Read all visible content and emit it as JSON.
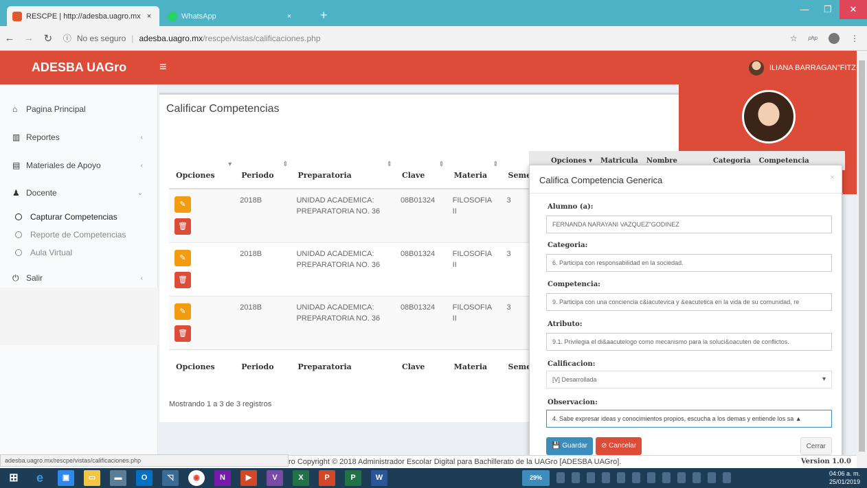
{
  "browser": {
    "tabs": [
      {
        "title": "RESCPE | http://adesba.uagro.mx",
        "close": "×"
      },
      {
        "title": "WhatsApp",
        "close": "×"
      }
    ],
    "new_tab": "+",
    "security": "No es seguro",
    "url_host": "adesba.uagro.mx",
    "url_path": "/rescpe/vistas/calificaciones.php",
    "ext_label": "php",
    "status_url": "adesba.uagro.mx/rescpe/vistas/calificaciones.php"
  },
  "header": {
    "brand": "ADESBA UAGro",
    "user": "ILIANA BARRAGAN\"FITZ"
  },
  "sidebar": {
    "items": [
      {
        "label": "Pagina Principal"
      },
      {
        "label": "Reportes"
      },
      {
        "label": "Materiales de Apoyo"
      },
      {
        "label": "Docente"
      },
      {
        "label": "Salir"
      }
    ],
    "sub_items": [
      {
        "label": "Capturar Competencias"
      },
      {
        "label": "Reporte de Competencias"
      },
      {
        "label": "Aula Virtual"
      }
    ]
  },
  "main": {
    "title": "Calificar Competencias",
    "columns": [
      "Opciones",
      "Periodo",
      "Preparatoria",
      "Clave",
      "Materia",
      "Semestr"
    ],
    "rows": [
      {
        "periodo": "2018B",
        "preparatoria": "UNIDAD ACADEMICA: PREPARATORIA NO. 36",
        "clave": "08B01324",
        "materia": "FILOSOFIA II",
        "semestre": "3"
      },
      {
        "periodo": "2018B",
        "preparatoria": "UNIDAD ACADEMICA: PREPARATORIA NO. 36",
        "clave": "08B01324",
        "materia": "FILOSOFIA II",
        "semestre": "3"
      },
      {
        "periodo": "2018B",
        "preparatoria": "UNIDAD ACADEMICA: PREPARATORIA NO. 36",
        "clave": "08B01324",
        "materia": "FILOSOFIA II",
        "semestre": "3"
      }
    ],
    "showing": "Mostrando 1 a 3 de 3 registros",
    "behind_columns": [
      "Opciones ▾",
      "Matricula",
      "Nombre",
      "Categoria",
      "Competencia"
    ]
  },
  "modal": {
    "title": "Califica Competencia Generica",
    "close_x": "×",
    "fields": {
      "alumno_label": "Alumno (a):",
      "alumno_value": "FERNANDA NARAYANI VAZQUEZ\"GODINEZ",
      "categoria_label": "Categoria:",
      "categoria_value": "6. Participa con responsabilidad en la sociedad.",
      "competencia_label": "Competencia:",
      "competencia_value": "9. Participa con una conciencia c&iacutevica y &eacutetica en la vida de su comunidad, re",
      "atributo_label": "Atributo:",
      "atributo_value": "9.1. Privilegia el di&aacutelogo como mecanismo para la soluci&oacuten de conflictos.",
      "calificacion_label": "Calificacion:",
      "calificacion_value": "[V] Desarrollada",
      "observacion_label": "Observacion:",
      "observacion_value": "4. Sabe expresar ideas y conocimientos propios, escucha a los demas y entiende los sa ▲"
    },
    "buttons": {
      "save": "Guardar",
      "cancel": "Cancelar",
      "close": "Cerrar"
    }
  },
  "footer": {
    "copyright": "ro Copyright © 2018 Administrador Escolar Digital para Bachillerato de la UAGro [ADESBA UAGro].",
    "version": "Version 1.0.0"
  },
  "taskbar": {
    "time": "04:06 a. m.",
    "date": "25/01/2019",
    "battery": "29%"
  },
  "colors": {
    "brand": "#dd4b39",
    "warning": "#f39c12",
    "primary": "#3c8dbc",
    "tab_bar": "#4db2c6"
  }
}
